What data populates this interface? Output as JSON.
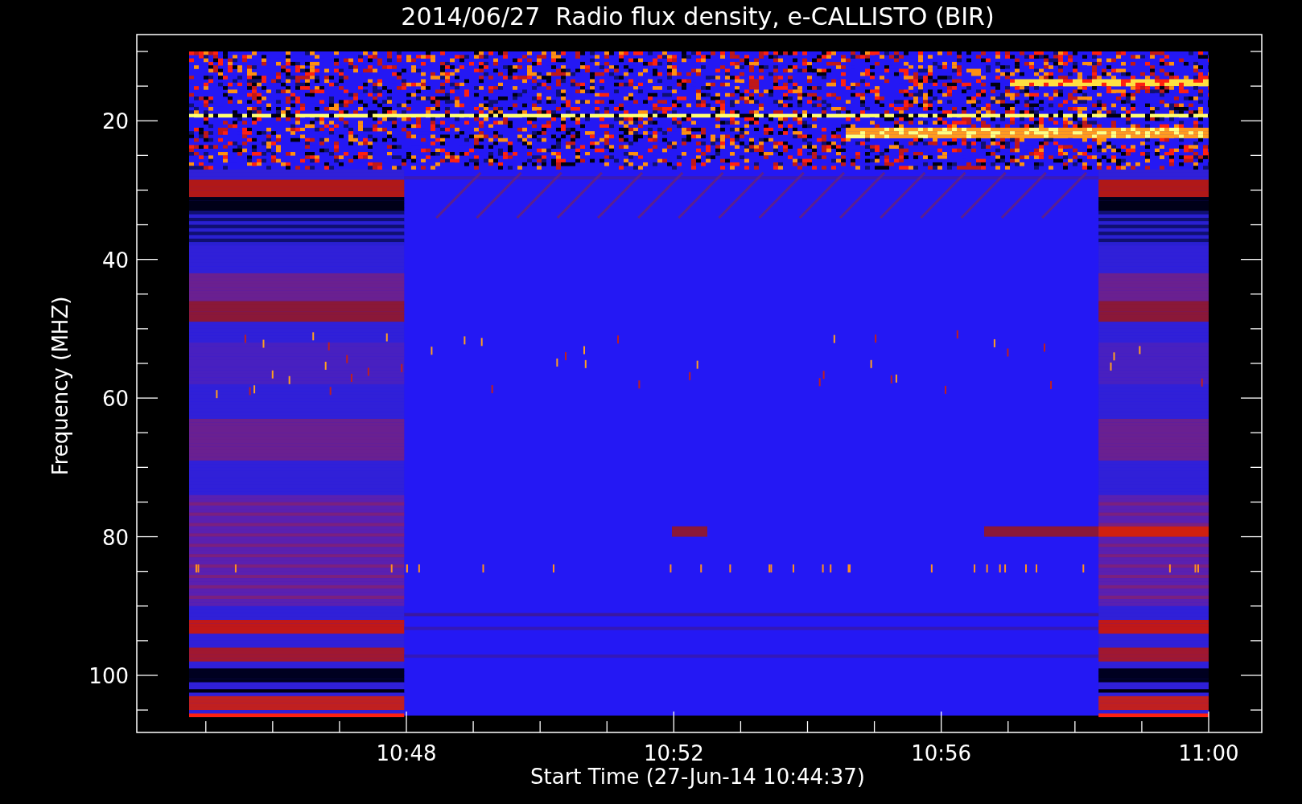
{
  "title": "2014/06/27  Radio flux density, e-CALLISTO (BIR)",
  "y_axis": {
    "label": "Frequency (MHZ)",
    "ticks": [
      {
        "label": "20"
      },
      {
        "label": "40"
      },
      {
        "label": "60"
      },
      {
        "label": "80"
      },
      {
        "label": "100"
      }
    ]
  },
  "x_axis": {
    "label": "Start Time (27-Jun-14 10:44:37)",
    "ticks": [
      {
        "label": "10:48"
      },
      {
        "label": "10:52"
      },
      {
        "label": "10:56"
      },
      {
        "label": "11:00"
      }
    ]
  }
}
